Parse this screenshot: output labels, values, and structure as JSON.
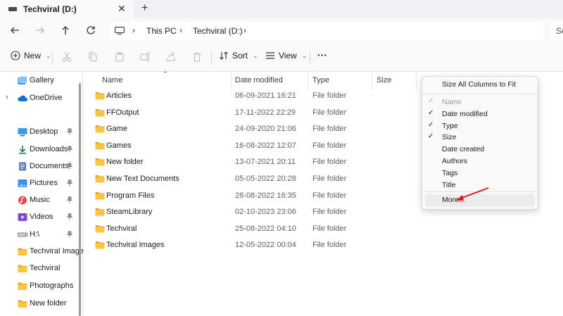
{
  "tab": {
    "title": "Techviral (D:)",
    "close": "✕",
    "new_tab": "+"
  },
  "address": {
    "crumbs": [
      "This PC",
      "Techviral (D:)"
    ],
    "search_partial": "Se"
  },
  "commands": {
    "new": "New",
    "sort": "Sort",
    "view": "View",
    "more": "···"
  },
  "sidebar": {
    "items": [
      {
        "label": "Gallery",
        "icon": "gallery-icon"
      },
      {
        "label": "OneDrive",
        "icon": "cloud-icon",
        "expandable": true
      },
      {
        "label": "Desktop",
        "icon": "desktop-icon",
        "pinned": true
      },
      {
        "label": "Downloads",
        "icon": "download-icon",
        "pinned": true
      },
      {
        "label": "Documents",
        "icon": "documents-icon",
        "pinned": true
      },
      {
        "label": "Pictures",
        "icon": "pictures-icon",
        "pinned": true
      },
      {
        "label": "Music",
        "icon": "music-icon",
        "pinned": true
      },
      {
        "label": "Videos",
        "icon": "videos-icon",
        "pinned": true
      },
      {
        "label": "H:\\",
        "icon": "drive-icon",
        "pinned": true
      },
      {
        "label": "Techviral Images",
        "icon": "folder-icon"
      },
      {
        "label": "Techviral",
        "icon": "folder-icon"
      },
      {
        "label": "Photographs",
        "icon": "folder-icon"
      },
      {
        "label": "New folder",
        "icon": "folder-icon"
      }
    ]
  },
  "columns": {
    "name": "Name",
    "date": "Date modified",
    "type": "Type",
    "size": "Size"
  },
  "files": [
    {
      "name": "Articles",
      "date": "06-09-2021 16:21",
      "type": "File folder"
    },
    {
      "name": "FFOutput",
      "date": "17-11-2022 22:29",
      "type": "File folder"
    },
    {
      "name": "Game",
      "date": "24-09-2020 21:06",
      "type": "File folder"
    },
    {
      "name": "Games",
      "date": "16-08-2022 12:07",
      "type": "File folder"
    },
    {
      "name": "New folder",
      "date": "13-07-2021 20:11",
      "type": "File folder"
    },
    {
      "name": "New Text Documents",
      "date": "05-05-2022 20:28",
      "type": "File folder"
    },
    {
      "name": "Program Files",
      "date": "28-08-2022 16:35",
      "type": "File folder"
    },
    {
      "name": "SteamLibrary",
      "date": "02-10-2023 23:06",
      "type": "File folder"
    },
    {
      "name": "Techviral",
      "date": "25-08-2022 04:10",
      "type": "File folder"
    },
    {
      "name": "Techviral Images",
      "date": "12-05-2022 00:04",
      "type": "File folder"
    }
  ],
  "menu": {
    "size_all": "Size All Columns to Fit",
    "items": [
      {
        "label": "Name",
        "checked": true,
        "disabled": true
      },
      {
        "label": "Date modified",
        "checked": true
      },
      {
        "label": "Type",
        "checked": true
      },
      {
        "label": "Size",
        "checked": true
      },
      {
        "label": "Date created",
        "checked": false
      },
      {
        "label": "Authors",
        "checked": false
      },
      {
        "label": "Tags",
        "checked": false
      },
      {
        "label": "Title",
        "checked": false
      }
    ],
    "more": "More...",
    "check_glyph": "✓"
  },
  "colors": {
    "folder": "#f8c643",
    "folder_dark": "#e2a82c",
    "accent": "#0067c0",
    "arrow": "#d71a1a"
  }
}
